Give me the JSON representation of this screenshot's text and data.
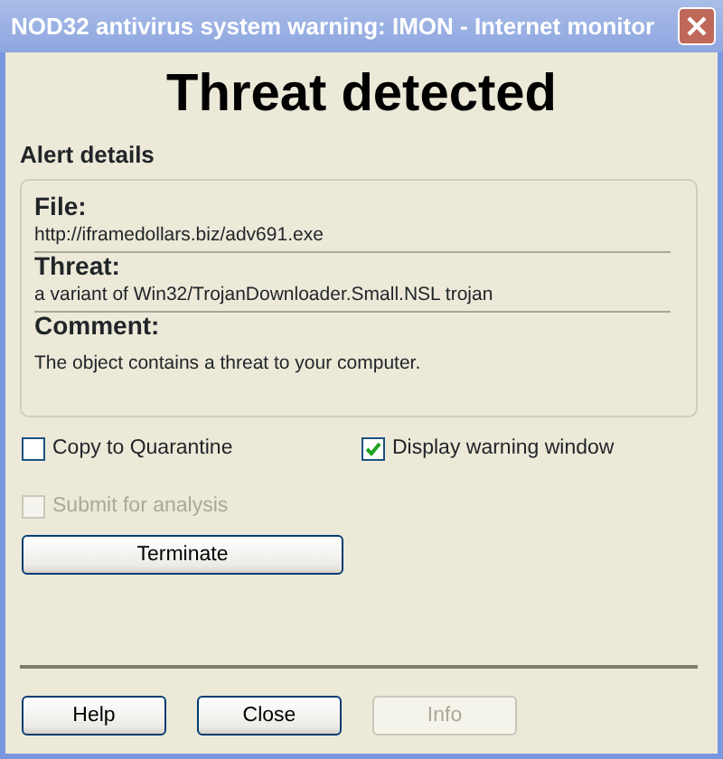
{
  "window": {
    "title": "NOD32 antivirus system warning: IMON - Internet monitor"
  },
  "heading": "Threat detected",
  "section_title": "Alert details",
  "details": [
    {
      "label": "File:",
      "value": "http://iframedollars.biz/adv691.exe"
    },
    {
      "label": "Threat:",
      "value": "a variant of Win32/TrojanDownloader.Small.NSL trojan"
    },
    {
      "label": "Comment:",
      "value": "The object contains a threat to your computer."
    }
  ],
  "options": [
    {
      "label": "Copy to Quarantine",
      "checked": false,
      "disabled": false
    },
    {
      "label": "Display warning window",
      "checked": true,
      "disabled": false
    },
    {
      "label": "Submit for analysis",
      "checked": false,
      "disabled": true
    }
  ],
  "action_button": {
    "label": "Terminate"
  },
  "buttons": [
    {
      "label": "Help",
      "disabled": false
    },
    {
      "label": "Close",
      "disabled": false
    },
    {
      "label": "Info",
      "disabled": true
    }
  ]
}
